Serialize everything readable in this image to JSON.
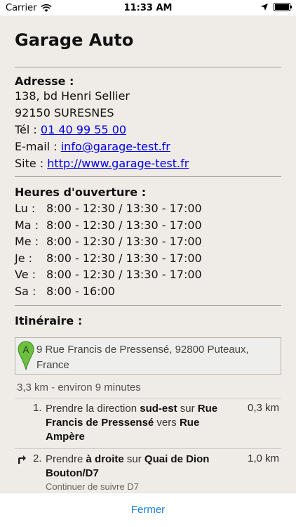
{
  "status_bar": {
    "carrier": "Carrier",
    "time": "11:33 AM"
  },
  "title": "Garage Auto",
  "address": {
    "heading": "Adresse :",
    "street": "138, bd Henri Sellier",
    "city": "92150 SURESNES",
    "phone_label": "Tél : ",
    "phone": "01 40 99 55 00",
    "email_label": "E-mail : ",
    "email": "info@garage-test.fr",
    "site_label": "Site : ",
    "site": "http://www.garage-test.fr"
  },
  "hours": {
    "heading": "Heures d'ouverture :",
    "rows": [
      {
        "day": "Lu :",
        "time": "8:00 - 12:30 / 13:30 - 17:00"
      },
      {
        "day": "Ma :",
        "time": "8:00 - 12:30 / 13:30 - 17:00"
      },
      {
        "day": "Me :",
        "time": "8:00 - 12:30 / 13:30 - 17:00"
      },
      {
        "day": "Je :",
        "time": "8:00 - 12:30 / 13:30 - 17:00"
      },
      {
        "day": "Ve :",
        "time": "8:00 - 12:30 / 13:30 - 17:00"
      },
      {
        "day": "Sa :",
        "time": "8:00 - 16:00"
      }
    ]
  },
  "itinerary": {
    "heading": "Itinéraire :",
    "marker": "A",
    "destination": "9 Rue Francis de Pressensé, 92800 Puteaux, France",
    "summary": "3,3 km - environ 9 minutes",
    "steps": [
      {
        "num": "1.",
        "parts": [
          {
            "t": "Prendre la direction ",
            "b": false
          },
          {
            "t": "sud-est",
            "b": true
          },
          {
            "t": " sur ",
            "b": false
          },
          {
            "t": "Rue Francis de Pressensé",
            "b": true
          },
          {
            "t": " vers ",
            "b": false
          },
          {
            "t": "Rue Ampère",
            "b": true
          }
        ],
        "distance": "0,3 km",
        "sub": "",
        "icon": ""
      },
      {
        "num": "2.",
        "parts": [
          {
            "t": "Prendre ",
            "b": false
          },
          {
            "t": "à droite",
            "b": true
          },
          {
            "t": " sur ",
            "b": false
          },
          {
            "t": "Quai de Dion Bouton/D7",
            "b": true
          }
        ],
        "distance": "1,0 km",
        "sub": "Continuer de suivre D7",
        "icon": "turn-right-icon"
      }
    ]
  },
  "footer": {
    "close_label": "Fermer"
  }
}
